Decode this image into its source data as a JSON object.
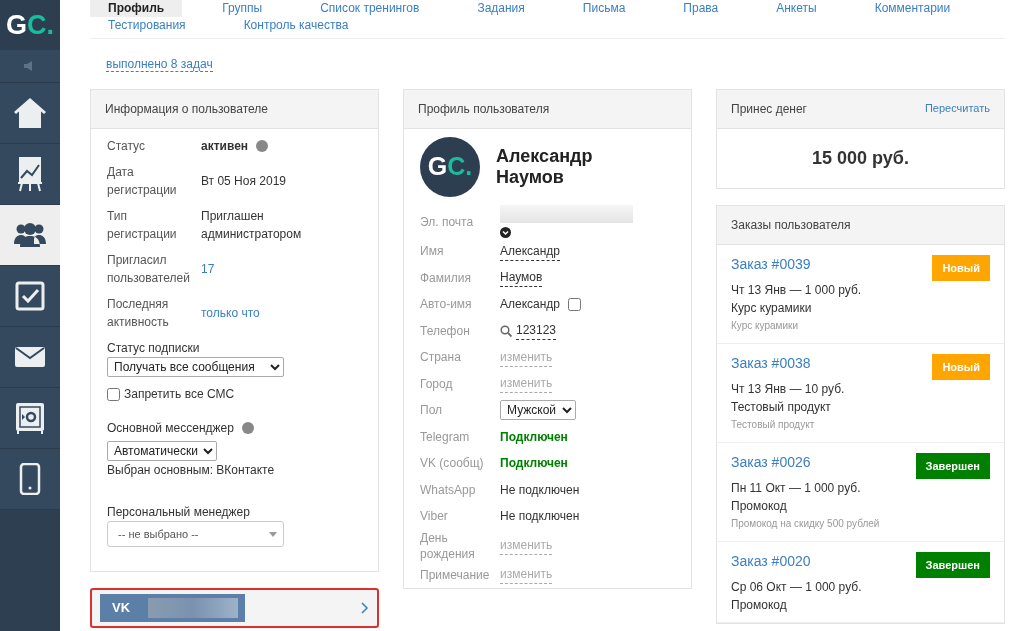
{
  "sidebar": {
    "logo": {
      "main": "G",
      "accent": "C."
    },
    "items": [
      {
        "kind": "speaker",
        "selected": false
      },
      {
        "kind": "home",
        "selected": false
      },
      {
        "kind": "chart",
        "selected": false
      },
      {
        "kind": "users",
        "selected": true
      },
      {
        "kind": "tasks",
        "selected": false
      },
      {
        "kind": "mail",
        "selected": false
      },
      {
        "kind": "safe",
        "selected": false
      },
      {
        "kind": "phone",
        "selected": false
      }
    ]
  },
  "tabs": [
    {
      "label": "Профиль",
      "selected": true
    },
    {
      "label": "Группы",
      "selected": false
    },
    {
      "label": "Список тренингов",
      "selected": false
    },
    {
      "label": "Задания",
      "selected": false
    },
    {
      "label": "Письма",
      "selected": false
    },
    {
      "label": "Права",
      "selected": false
    },
    {
      "label": "Анкеты",
      "selected": false
    },
    {
      "label": "Комментарии",
      "selected": false
    },
    {
      "label": "Тестирования",
      "selected": false
    },
    {
      "label": "Контроль качества",
      "selected": false
    }
  ],
  "tasks_link": "выполнено 8 задач",
  "user_info": {
    "title": "Информация о пользователе",
    "rows": [
      {
        "label": "Статус",
        "value": "активен",
        "kind": "bold-help"
      },
      {
        "label": "Дата регистрации",
        "value": "Вт 05 Ноя 2019",
        "kind": "text"
      },
      {
        "label": "Тип регистрации",
        "value": "Приглашен администратором",
        "kind": "text"
      },
      {
        "label": "Пригласил пользователей",
        "value": "17",
        "kind": "link"
      },
      {
        "label": "Последняя активность",
        "value": "только что",
        "kind": "link"
      }
    ],
    "subscription": {
      "label": "Статус подписки",
      "value": "Получать все сообщения"
    },
    "block_sms": {
      "label": "Запретить все СМС",
      "checked": false
    },
    "messenger": {
      "label": "Основной мессенджер",
      "value": "Автоматически",
      "note": "Выбран основным: ВКонтакте"
    },
    "manager": {
      "label": "Персональный менеджер",
      "value": "-- не выбрано --"
    }
  },
  "vk_banner": {
    "logo": "VK"
  },
  "profile": {
    "title": "Профиль пользователя",
    "avatar": {
      "main": "G",
      "accent": "C."
    },
    "name": "Александр Наумов",
    "fields": [
      {
        "label": "Эл. почта",
        "kind": "redacted"
      },
      {
        "label": "Имя",
        "value": "Александр",
        "kind": "editable"
      },
      {
        "label": "Фамилия",
        "value": "Наумов",
        "kind": "editable"
      },
      {
        "label": "Авто-имя",
        "value": "Александр",
        "kind": "checkbox",
        "checked": false
      },
      {
        "label": "Телефон",
        "value": "123123",
        "kind": "phone"
      },
      {
        "label": "Страна",
        "value": "изменить",
        "kind": "empty-edit"
      },
      {
        "label": "Город",
        "value": "изменить",
        "kind": "empty-edit"
      },
      {
        "label": "Пол",
        "value": "Мужской",
        "kind": "select"
      },
      {
        "label": "Telegram",
        "value": "Подключен",
        "kind": "status",
        "connected": true
      },
      {
        "label": "VK (сообщ)",
        "value": "Подключен",
        "kind": "status",
        "connected": true
      },
      {
        "label": "WhatsApp",
        "value": "Не подключен",
        "kind": "status",
        "connected": false
      },
      {
        "label": "Viber",
        "value": "Не подключен",
        "kind": "status",
        "connected": false
      },
      {
        "label": "День рождения",
        "value": "изменить",
        "kind": "empty-edit"
      },
      {
        "label": "Примечание",
        "value": "изменить",
        "kind": "empty-edit"
      }
    ]
  },
  "money": {
    "title": "Принес денег",
    "action": "Пересчитать",
    "amount": "15 000 руб."
  },
  "orders": {
    "title": "Заказы пользователя",
    "items": [
      {
        "title": "Заказ #0039",
        "date": "Чт 13 Янв — 1 000 руб.",
        "product": "Курс курамики",
        "description": "Курс курамики",
        "status": "Новый",
        "kind": "new"
      },
      {
        "title": "Заказ #0038",
        "date": "Чт 13 Янв — 10 руб.",
        "product": "Тестовый продукт",
        "description": "Тестовый продукт",
        "status": "Новый",
        "kind": "new"
      },
      {
        "title": "Заказ #0026",
        "date": "Пн 11 Окт — 1 000 руб.",
        "product": "Промокод",
        "description": "Промокод на скидку 500 рублей",
        "status": "Завершен",
        "kind": "done"
      },
      {
        "title": "Заказ #0020",
        "date": "Ср 06 Окт — 1 000 руб.",
        "product": "Промокод",
        "status": "Завершен",
        "kind": "done"
      }
    ]
  }
}
